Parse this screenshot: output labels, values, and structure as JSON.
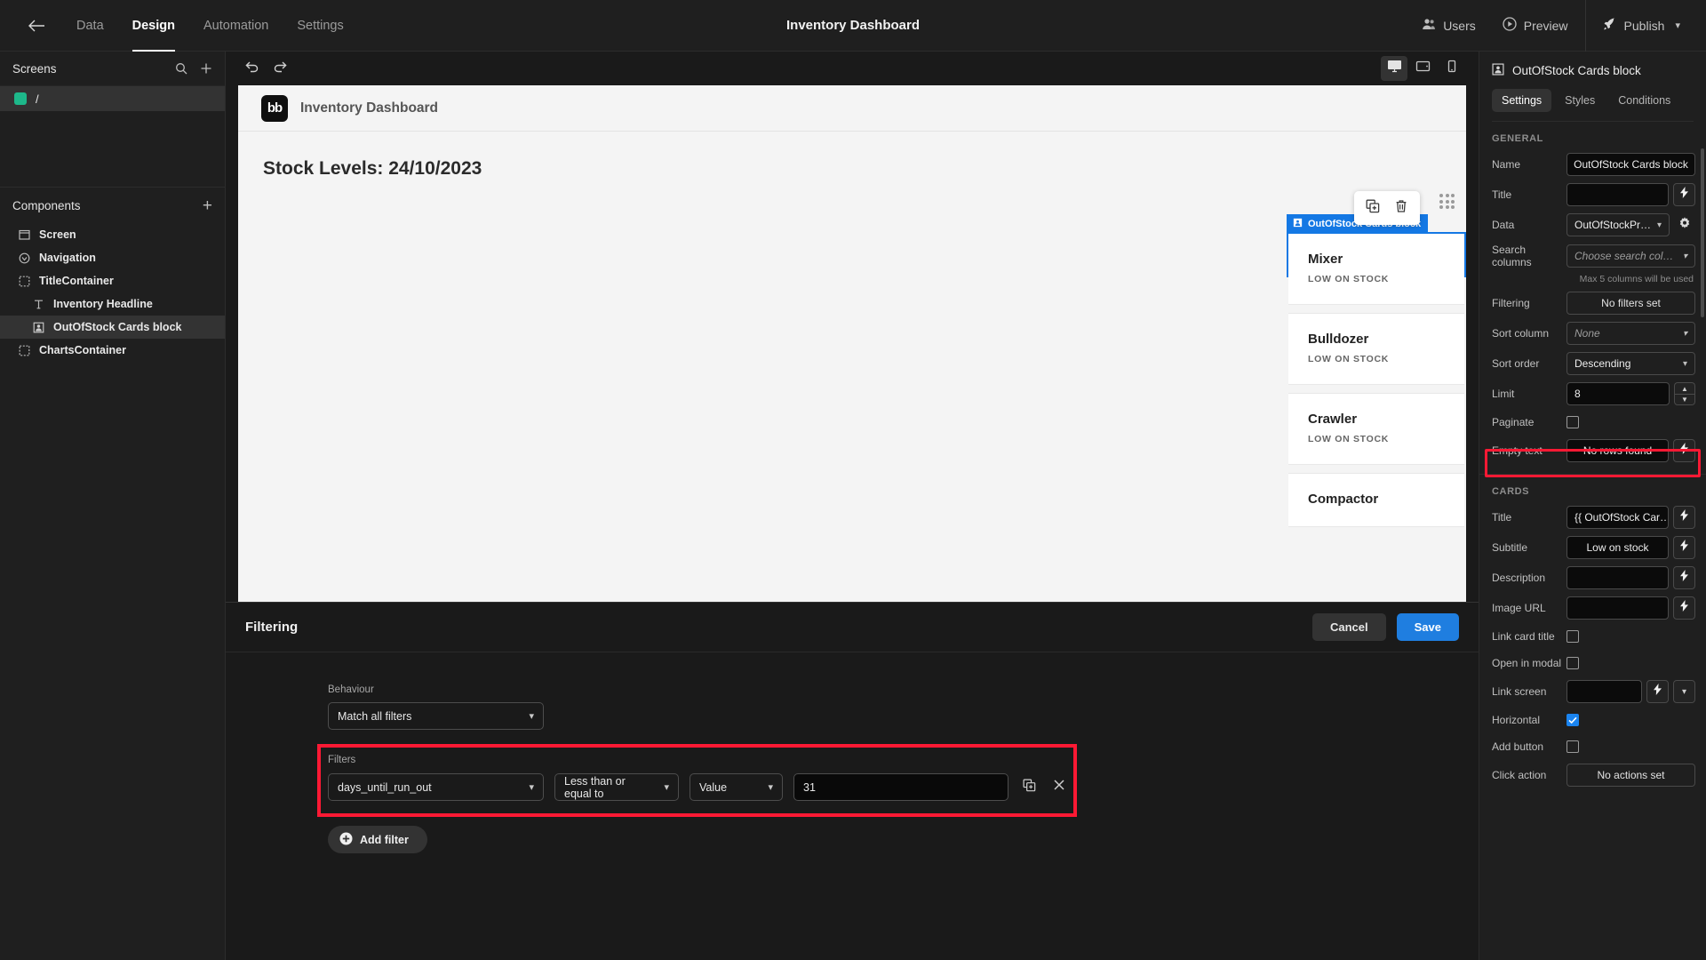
{
  "topbar": {
    "back_icon": "arrow-left-icon",
    "tabs": [
      {
        "label": "Data",
        "active": false
      },
      {
        "label": "Design",
        "active": true
      },
      {
        "label": "Automation",
        "active": false
      },
      {
        "label": "Settings",
        "active": false
      }
    ],
    "title": "Inventory Dashboard",
    "users_label": "Users",
    "preview_label": "Preview",
    "publish_label": "Publish"
  },
  "left": {
    "screens_title": "Screens",
    "screen_route": "/",
    "components_title": "Components",
    "components": [
      {
        "label": "Screen",
        "icon": "screen-icon",
        "depth": 0,
        "selected": false
      },
      {
        "label": "Navigation",
        "icon": "navigation-icon",
        "depth": 0,
        "selected": false
      },
      {
        "label": "TitleContainer",
        "icon": "container-icon",
        "depth": 0,
        "selected": false
      },
      {
        "label": "Inventory Headline",
        "icon": "text-icon",
        "depth": 1,
        "selected": false
      },
      {
        "label": "OutOfStock Cards block",
        "icon": "cards-block-icon",
        "depth": 1,
        "selected": true
      },
      {
        "label": "ChartsContainer",
        "icon": "container-icon",
        "depth": 0,
        "selected": false
      }
    ]
  },
  "canvas": {
    "undo_icon": "undo-icon",
    "redo_icon": "redo-icon",
    "devices": [
      {
        "name": "desktop-icon",
        "active": true
      },
      {
        "name": "tablet-icon",
        "active": false
      },
      {
        "name": "mobile-icon",
        "active": false
      }
    ],
    "app_logo_text": "bb",
    "app_title": "Inventory Dashboard",
    "headline": "Stock Levels: 24/10/2023",
    "float_actions": [
      "duplicate-icon",
      "delete-icon"
    ],
    "block_label": "OutOfStock Cards block",
    "cards": [
      {
        "title": "Mixer",
        "subtitle": "LOW ON STOCK"
      },
      {
        "title": "Bulldozer",
        "subtitle": "LOW ON STOCK"
      },
      {
        "title": "Crawler",
        "subtitle": "LOW ON STOCK"
      },
      {
        "title": "Compactor",
        "subtitle": ""
      }
    ]
  },
  "drawer": {
    "title": "Filtering",
    "cancel_label": "Cancel",
    "save_label": "Save",
    "behaviour_label": "Behaviour",
    "behaviour_value": "Match all filters",
    "filters_label": "Filters",
    "filter_column": "days_until_run_out",
    "filter_operator": "Less than or equal to",
    "filter_value_type": "Value",
    "filter_value": "31",
    "binding_icon": "binding-icon",
    "remove_icon": "close-icon",
    "add_filter_label": "Add filter"
  },
  "right": {
    "header_title": "OutOfStock Cards block",
    "header_icon": "cards-block-icon",
    "tabs": [
      {
        "label": "Settings",
        "active": true
      },
      {
        "label": "Styles",
        "active": false
      },
      {
        "label": "Conditions",
        "active": false
      }
    ],
    "general_title": "GENERAL",
    "general": {
      "name_label": "Name",
      "name_value": "OutOfStock Cards block",
      "title_label": "Title",
      "title_value": "",
      "data_label": "Data",
      "data_value": "OutOfStockPr…",
      "search_columns_label": "Search columns",
      "search_columns_placeholder": "Choose search col…",
      "search_columns_hint": "Max 5 columns will be used",
      "filtering_label": "Filtering",
      "filtering_value": "No filters set",
      "sort_column_label": "Sort column",
      "sort_column_value": "None",
      "sort_order_label": "Sort order",
      "sort_order_value": "Descending",
      "limit_label": "Limit",
      "limit_value": "8",
      "paginate_label": "Paginate",
      "paginate_checked": false,
      "empty_text_label": "Empty text",
      "empty_text_value": "No rows found"
    },
    "cards_title": "CARDS",
    "cards": {
      "title_label": "Title",
      "title_value": "{{ OutOfStock Car…",
      "subtitle_label": "Subtitle",
      "subtitle_value": "Low on stock",
      "description_label": "Description",
      "description_value": "",
      "image_url_label": "Image URL",
      "image_url_value": "",
      "link_card_title_label": "Link card title",
      "link_card_title_checked": false,
      "open_in_modal_label": "Open in modal",
      "open_in_modal_checked": false,
      "link_screen_label": "Link screen",
      "link_screen_value": "",
      "horizontal_label": "Horizontal",
      "horizontal_checked": true,
      "add_button_label": "Add button",
      "add_button_checked": false,
      "click_action_label": "Click action",
      "click_action_value": "No actions set"
    }
  },
  "colors": {
    "accent_blue": "#1f7ee0",
    "highlight_red": "#fd1934",
    "selection_blue": "#1478e4",
    "screen_dot_green": "#1db88a"
  }
}
